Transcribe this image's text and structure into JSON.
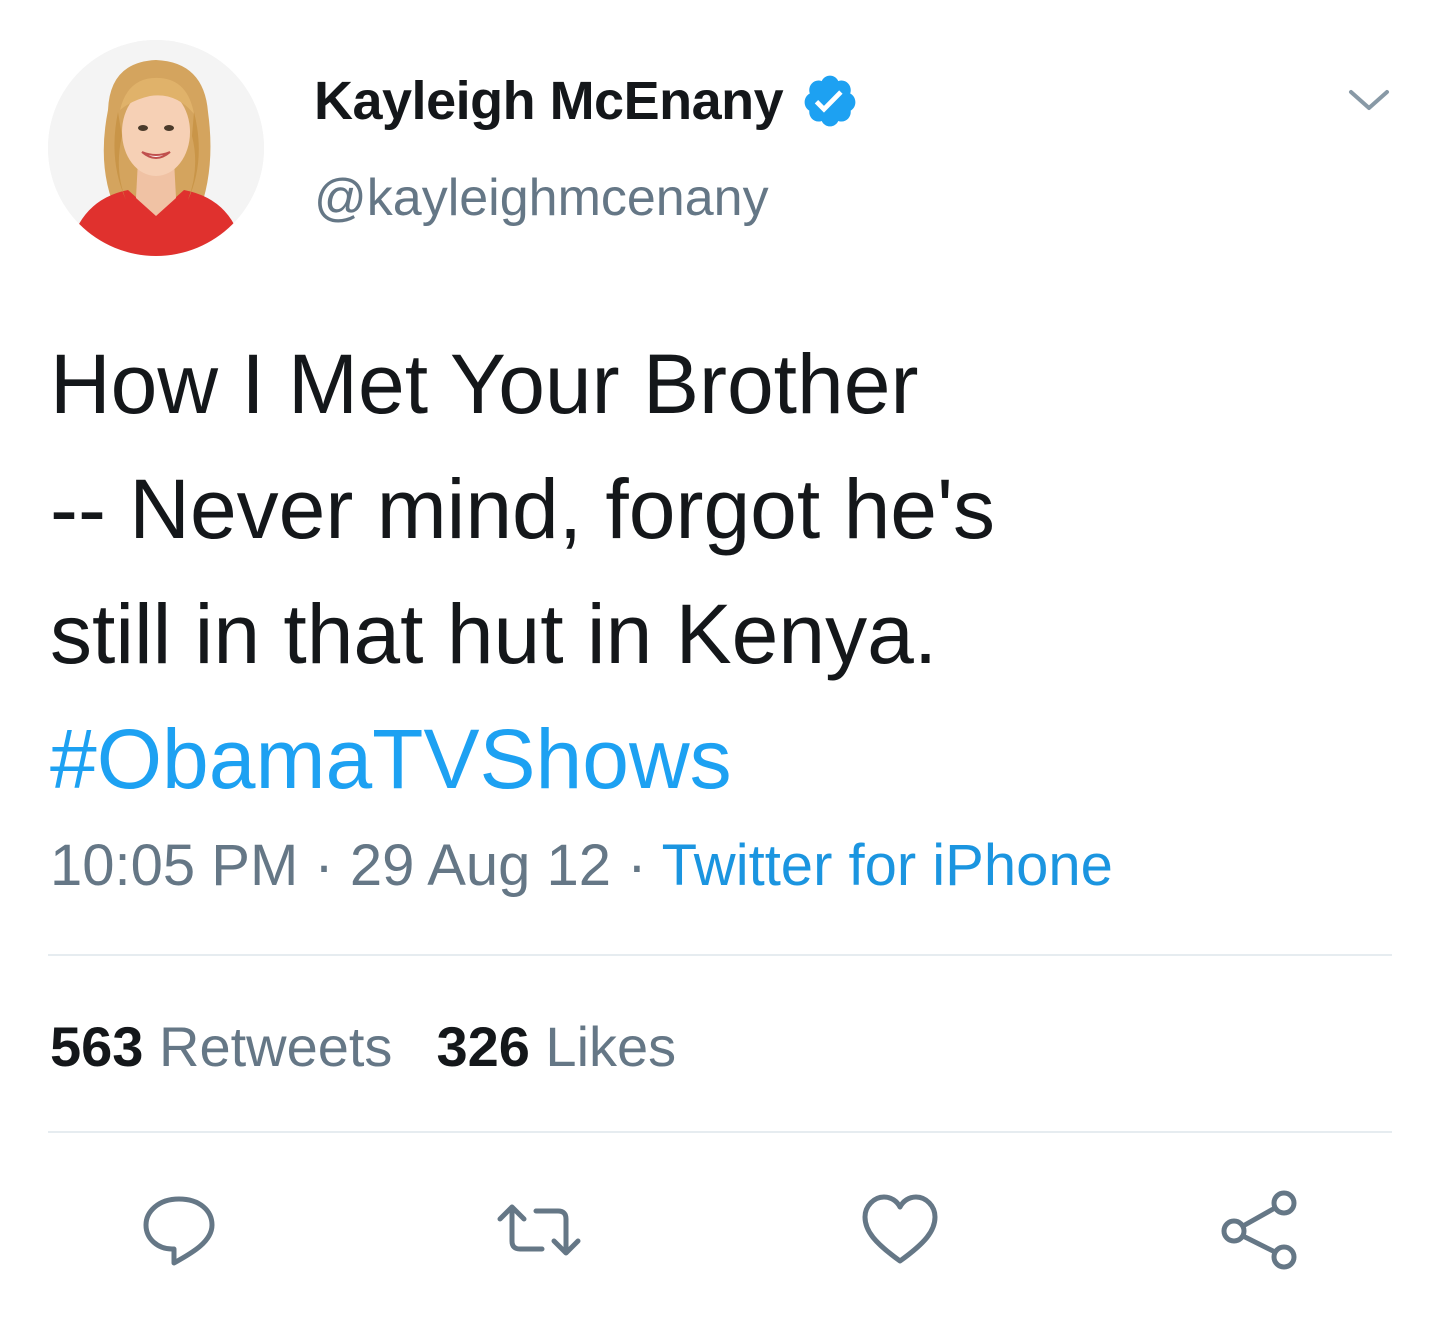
{
  "user": {
    "display_name": "Kayleigh McEnany",
    "handle": "@kayleighmcenany",
    "verified": true
  },
  "tweet": {
    "lines": [
      "How I Met Your Brother",
      "-- Never mind, forgot he's",
      "still in that hut in Kenya."
    ],
    "hashtag": "#ObamaTVShows",
    "time": "10:05 PM",
    "separator": " · ",
    "date": "29 Aug 12",
    "source": "Twitter for iPhone"
  },
  "stats": {
    "retweets_count": "563",
    "retweets_label": " Retweets",
    "likes_count": "326",
    "likes_label": " Likes"
  },
  "icons": {
    "verified": "verified-badge-icon",
    "menu": "chevron-down-icon",
    "reply": "reply-icon",
    "retweet": "retweet-icon",
    "like": "heart-icon",
    "share": "share-icon"
  },
  "colors": {
    "text": "#14171a",
    "secondary": "#657786",
    "link": "#1da1f2",
    "divider": "#e6ecf0",
    "verified": "#1da1f2"
  }
}
